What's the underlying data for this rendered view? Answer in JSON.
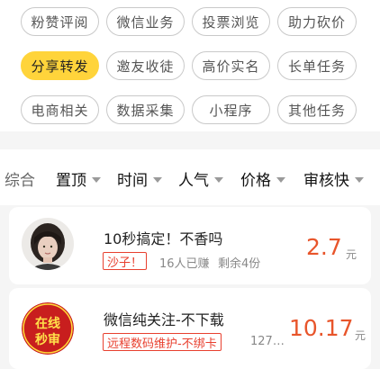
{
  "categories": [
    {
      "label": "粉赞评阅"
    },
    {
      "label": "微信业务"
    },
    {
      "label": "投票浏览"
    },
    {
      "label": "助力砍价"
    },
    {
      "label": "分享转发"
    },
    {
      "label": "邀友收徒"
    },
    {
      "label": "高价实名"
    },
    {
      "label": "长单任务"
    },
    {
      "label": "电商相关"
    },
    {
      "label": "数据采集"
    },
    {
      "label": "小程序"
    },
    {
      "label": "其他任务"
    }
  ],
  "sort": {
    "items": [
      "综合",
      "置顶",
      "时间",
      "人气",
      "价格",
      "审核快"
    ]
  },
  "tasks": [
    {
      "title": "10秒搞定！不香吗",
      "tag": "沙子！",
      "earned": "16人已赚",
      "remaining": "剩余4份",
      "price": "2.7",
      "unit": "元"
    },
    {
      "title": "微信纯关注-不下载",
      "tag": "远程数码维护-不绑卡",
      "earned": "127…",
      "price": "10.17",
      "unit": "元",
      "logo_text": [
        "在线",
        "秒审"
      ]
    }
  ],
  "colors": {
    "accent": "#ffd43b",
    "price": "#e8552b",
    "tag": "#e8402f"
  }
}
